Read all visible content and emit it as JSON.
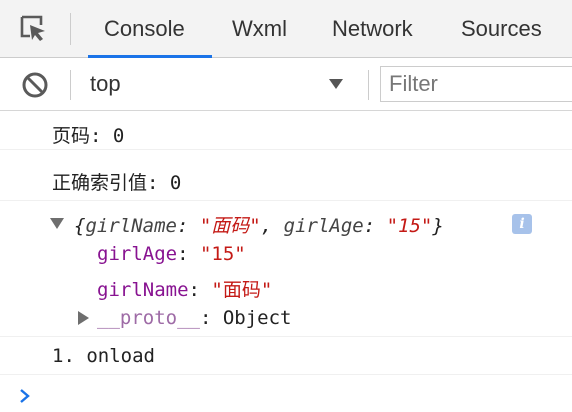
{
  "tabs": [
    {
      "label": "Console",
      "active": true
    },
    {
      "label": "Wxml",
      "active": false
    },
    {
      "label": "Network",
      "active": false
    },
    {
      "label": "Sources",
      "active": false
    }
  ],
  "toolbar": {
    "context": "top",
    "filter_placeholder": "Filter"
  },
  "messages": {
    "page": "页码: 0",
    "index": "正确索引值: 0",
    "object": {
      "summary_open": "{",
      "key1": "girlName",
      "colon1": ": ",
      "val1": "\"面码\"",
      "sep": ", ",
      "key2": "girlAge",
      "colon2": ": ",
      "val2": "\"15\"",
      "summary_close": "}",
      "info": "i",
      "props": [
        {
          "key": "girlAge",
          "colon": ": ",
          "value": "\"15\""
        },
        {
          "key": "girlName",
          "colon": ": ",
          "value": "\"面码\""
        }
      ],
      "proto_key": "__proto__",
      "proto_colon": ": ",
      "proto_value": "Object"
    },
    "onload": "1. onload"
  },
  "colors": {
    "accent": "#1a73e8",
    "string": "#c41a16",
    "property": "#881391"
  }
}
